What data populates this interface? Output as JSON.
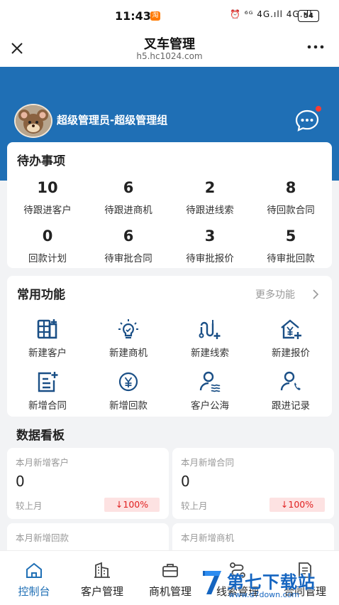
{
  "status_bar": {
    "time": "11:43",
    "taobao_badge": "淘",
    "signal_text": "⏰ ⁶ᴳ 4G.ıll 4G.ıll",
    "battery": "54"
  },
  "navbar": {
    "title": "叉车管理",
    "url": "h5.hc1024.com"
  },
  "user": {
    "name": "超级管理员-超级管理组"
  },
  "todo": {
    "title": "待办事项",
    "items": [
      {
        "count": "10",
        "label": "待跟进客户"
      },
      {
        "count": "6",
        "label": "待跟进商机"
      },
      {
        "count": "2",
        "label": "待跟进线索"
      },
      {
        "count": "8",
        "label": "待回款合同"
      },
      {
        "count": "0",
        "label": "回款计划"
      },
      {
        "count": "6",
        "label": "待审批合同"
      },
      {
        "count": "3",
        "label": "待审批报价"
      },
      {
        "count": "5",
        "label": "待审批回款"
      }
    ]
  },
  "functions": {
    "title": "常用功能",
    "more": "更多功能",
    "items": [
      {
        "label": "新建客户",
        "icon": "new-customer-icon"
      },
      {
        "label": "新建商机",
        "icon": "new-opportunity-icon"
      },
      {
        "label": "新建线索",
        "icon": "new-lead-icon"
      },
      {
        "label": "新建报价",
        "icon": "new-quote-icon"
      },
      {
        "label": "新增合同",
        "icon": "new-contract-icon"
      },
      {
        "label": "新增回款",
        "icon": "new-payment-icon"
      },
      {
        "label": "客户公海",
        "icon": "customer-pool-icon"
      },
      {
        "label": "跟进记录",
        "icon": "follow-record-icon"
      }
    ]
  },
  "dashboard": {
    "title": "数据看板",
    "stats": [
      {
        "label": "本月新增客户",
        "value": "0",
        "compare": "较上月",
        "change": "↓100%"
      },
      {
        "label": "本月新增合同",
        "value": "0",
        "compare": "较上月",
        "change": "↓100%"
      },
      {
        "label": "本月新增回款"
      },
      {
        "label": "本月新增商机"
      }
    ]
  },
  "tabbar": {
    "items": [
      {
        "label": "控制台",
        "active": true
      },
      {
        "label": "客户管理"
      },
      {
        "label": "商机管理"
      },
      {
        "label": "线索管理"
      },
      {
        "label": "合同管理"
      }
    ]
  },
  "watermark": {
    "text": "第七下载站",
    "url": "www.d7down.com"
  },
  "colors": {
    "primary": "#1f6fb5",
    "badge_bg": "#fde2e2",
    "badge_text": "#e02020",
    "notify_dot": "#ff3b30"
  }
}
